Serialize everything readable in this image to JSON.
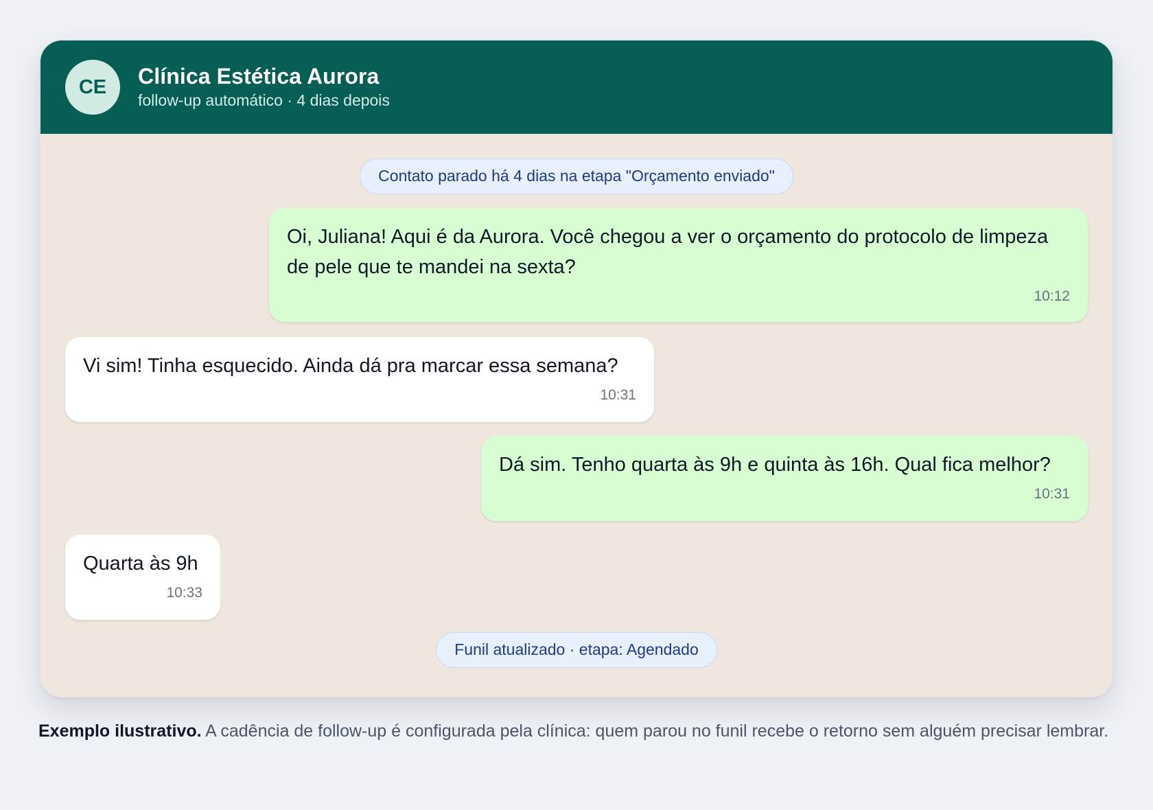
{
  "header": {
    "avatar_initials": "CE",
    "title": "Clínica Estética Aurora",
    "subtitle": "follow-up automático · 4 dias depois",
    "background_color": "#075e54"
  },
  "system_notes": [
    "Contato parado há 4 dias na etapa \"Orçamento enviado\"",
    "Funil atualizado · etapa: Agendado"
  ],
  "messages": [
    {
      "direction": "outgoing",
      "text": "Oi, Juliana! Aqui é da Aurora. Você chegou a ver o orçamento do protocolo de limpeza de pele que te mandei na sexta?",
      "time": "10:12"
    },
    {
      "direction": "incoming",
      "text": "Vi sim! Tinha esquecido. Ainda dá pra marcar essa semana?",
      "time": "10:31"
    },
    {
      "direction": "outgoing",
      "text": "Dá sim. Tenho quarta às 9h e quinta às 16h. Qual fica melhor?",
      "time": "10:31"
    },
    {
      "direction": "incoming",
      "text": "Quarta às 9h",
      "time": "10:33"
    }
  ],
  "caption": {
    "lead": "Exemplo ilustrativo.",
    "text": " A cadência de follow-up é configurada pela clínica: quem parou no funil recebe o retorno sem alguém precisar lembrar."
  },
  "colors": {
    "outgoing_bubble": "#d9fdd3",
    "incoming_bubble": "#ffffff",
    "chat_background": "#efe6dd",
    "system_note": "#e8f0fd"
  }
}
